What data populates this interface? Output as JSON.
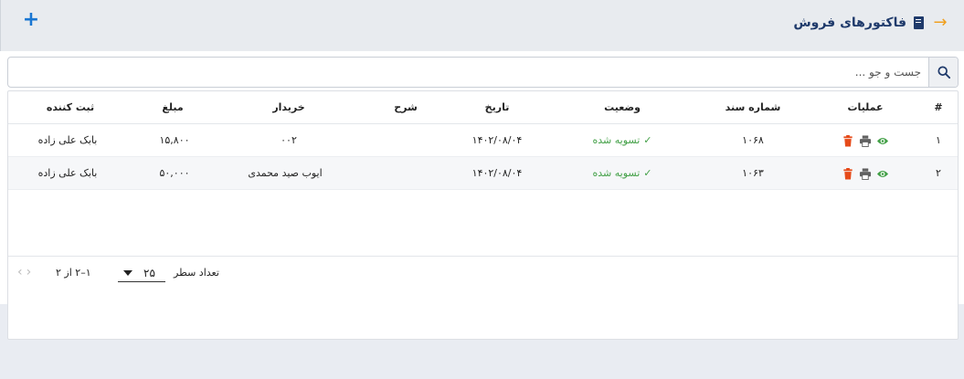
{
  "header": {
    "title": "فاکتورهای فروش",
    "add_icon": "plus-icon",
    "back_icon": "arrow-right-icon",
    "title_icon": "book-icon"
  },
  "search": {
    "placeholder": "جست و جو ...",
    "value": "",
    "icon": "search-icon"
  },
  "table": {
    "columns": [
      "#",
      "عملیات",
      "شماره سند",
      "وضعیت",
      "تاریخ",
      "شرح",
      "خریدار",
      "مبلغ",
      "ثبت کننده"
    ],
    "rows": [
      {
        "index": "۱",
        "doc_no": "۱۰۶۸",
        "status": "تسویه شده",
        "date": "۱۴۰۲/۰۸/۰۴",
        "desc": "",
        "buyer": "۰۰۲",
        "amount": "۱۵,۸۰۰",
        "registrar": "بابک علی زاده"
      },
      {
        "index": "۲",
        "doc_no": "۱۰۶۳",
        "status": "تسویه شده",
        "date": "۱۴۰۲/۰۸/۰۴",
        "desc": "",
        "buyer": "ایوب صید محمدی",
        "amount": "۵۰,۰۰۰",
        "registrar": "بابک علی زاده"
      }
    ]
  },
  "footer": {
    "rows_per_page_label": "تعداد سطر",
    "rows_per_page_value": "۲۵",
    "range": "۱–۲ از ۲"
  },
  "colors": {
    "accent": "#1976d2",
    "title": "#1f3a6b",
    "back_arrow": "#f0a020",
    "success": "#43a047",
    "delete": "#e64a19",
    "print": "#616161"
  }
}
